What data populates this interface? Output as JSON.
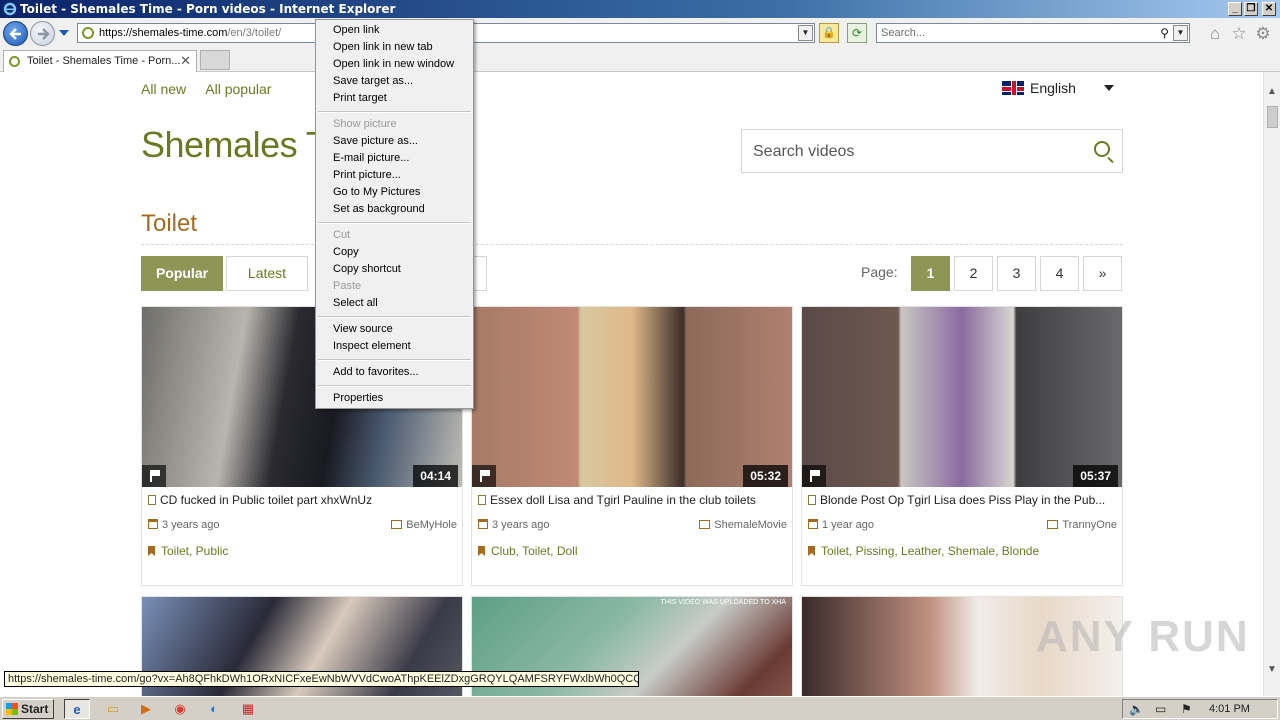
{
  "window": {
    "title": "Toilet - Shemales Time - Porn videos - Internet Explorer",
    "minimize": "_",
    "maximize": "❐",
    "close": "✕"
  },
  "address": {
    "url_main": "https://shemales-time.com",
    "url_rest": "/en/3/toilet/",
    "search_placeholder": "Search..."
  },
  "tab": {
    "title": "Toilet - Shemales Time - Porn...",
    "close": "✕"
  },
  "site": {
    "nav": [
      "All new",
      "All popular"
    ],
    "language": "English",
    "logo": "Shemales T",
    "search_placeholder": "Search videos",
    "page_title": "Toilet",
    "sort": {
      "popular": "Popular",
      "latest": "Latest"
    },
    "pager_label": "Page:",
    "pages": [
      "1",
      "2",
      "3",
      "4",
      "»"
    ],
    "active_page": "1",
    "accent_color": "#6b7a22"
  },
  "videos": [
    {
      "title": "CD fucked in Public toilet part xhxWnUz",
      "duration": "04:14",
      "date": "3 years ago",
      "source": "BeMyHole",
      "tags": "Toilet, Public"
    },
    {
      "title": "Essex doll Lisa and Tgirl Pauline in the club toilets",
      "duration": "05:32",
      "date": "3 years ago",
      "source": "ShemaleMovie",
      "tags": "Club, Toilet, Doll"
    },
    {
      "title": "Blonde Post Op Tgirl Lisa does Piss Play in the Pub...",
      "duration": "05:37",
      "date": "1 year ago",
      "source": "TrannyOne",
      "tags": "Toilet, Pissing, Leather, Shemale, Blonde"
    }
  ],
  "row2_caption": "THIS VIDEO WAS UPLOADED TO XHA",
  "context_menu": {
    "items": [
      {
        "label": "Open link",
        "disabled": false
      },
      {
        "label": "Open link in new tab",
        "disabled": false
      },
      {
        "label": "Open link in new window",
        "disabled": false
      },
      {
        "label": "Save target as...",
        "disabled": false
      },
      {
        "label": "Print target",
        "disabled": false
      },
      {
        "label": "Show picture",
        "disabled": true
      },
      {
        "label": "Save picture as...",
        "disabled": false
      },
      {
        "label": "E-mail picture...",
        "disabled": false
      },
      {
        "label": "Print picture...",
        "disabled": false
      },
      {
        "label": "Go to My Pictures",
        "disabled": false
      },
      {
        "label": "Set as background",
        "disabled": false
      },
      {
        "label": "Cut",
        "disabled": true
      },
      {
        "label": "Copy",
        "disabled": false
      },
      {
        "label": "Copy shortcut",
        "disabled": false
      },
      {
        "label": "Paste",
        "disabled": true
      },
      {
        "label": "Select all",
        "disabled": false
      },
      {
        "label": "View source",
        "disabled": false
      },
      {
        "label": "Inspect element",
        "disabled": false
      },
      {
        "label": "Add to favorites...",
        "disabled": false
      },
      {
        "label": "Properties",
        "disabled": false
      }
    ]
  },
  "status_url": "https://shemales-time.com/go?vx=Ah8QFhkDWh1ORxNICFxeEwNbWVVdCwoAThpKEElZDxgGRQYLQAMFSRYFWxlbWh0QCQNW...",
  "watermark": "ANY RUN",
  "taskbar": {
    "start": "Start",
    "clock": "4:01 PM"
  }
}
